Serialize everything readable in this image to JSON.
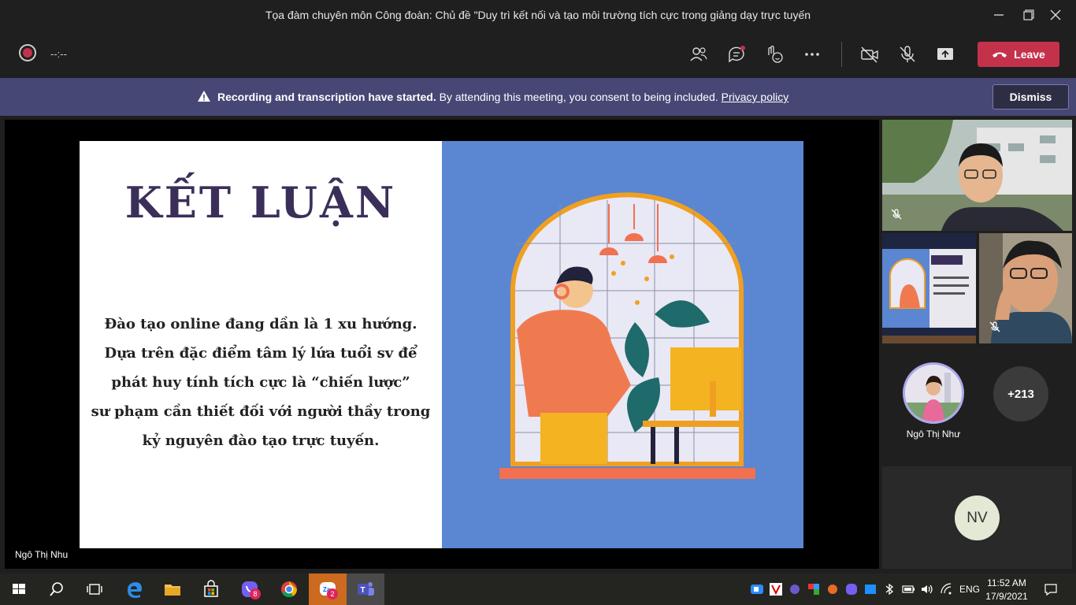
{
  "window": {
    "title": "Tọa đàm chuyên môn Công đoàn: Chủ đề \"Duy trì kết nối và tạo môi trường tích cực trong giảng dạy trực tuyến"
  },
  "toolbar": {
    "timer": "--:--",
    "leave_label": "Leave"
  },
  "banner": {
    "bold_text": "Recording and transcription have started.",
    "text": " By attending this meeting, you consent to being included. ",
    "link_text": "Privacy policy",
    "dismiss_label": "Dismiss"
  },
  "slide": {
    "title": "KẾT LUẬN",
    "body_lines": [
      "Đào tạo online đang dần là 1 xu hướng.",
      "Dựa trên đặc điểm tâm lý lứa tuổi sv để",
      "phát huy tính tích cực là “chiến lược”",
      "sư phạm cần thiết đối với người thầy trong",
      "kỷ nguyên đào tạo trực tuyến."
    ]
  },
  "presenter": {
    "name": "Ngô Thị Nhu"
  },
  "participants": {
    "avatar_name": "Ngô Thị Như",
    "more_count": "+213",
    "initials": "NV"
  },
  "taskbar": {
    "viber_badge": "8",
    "zalo_badge": "2",
    "language": "ENG",
    "time": "11:52 AM",
    "date": "17/9/2021"
  },
  "colors": {
    "leave": "#c4314b",
    "banner": "#464775",
    "slide_title": "#3b2f5a",
    "slide_right_bg": "#5b86d2"
  }
}
